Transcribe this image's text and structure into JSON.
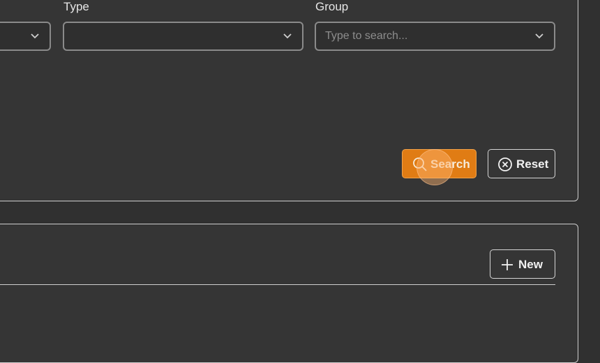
{
  "filters": {
    "type_label": "Type",
    "type_value": "",
    "group_label": "Group",
    "group_placeholder": "Type to search..."
  },
  "actions": {
    "search_label": "Search",
    "reset_label": "Reset",
    "new_label": "New"
  },
  "colors": {
    "accent": "#e07c14",
    "background": "#303030",
    "card": "#353535"
  },
  "icons": [
    "chevron-down-icon",
    "search-icon",
    "close-circle-icon",
    "plus-icon"
  ]
}
